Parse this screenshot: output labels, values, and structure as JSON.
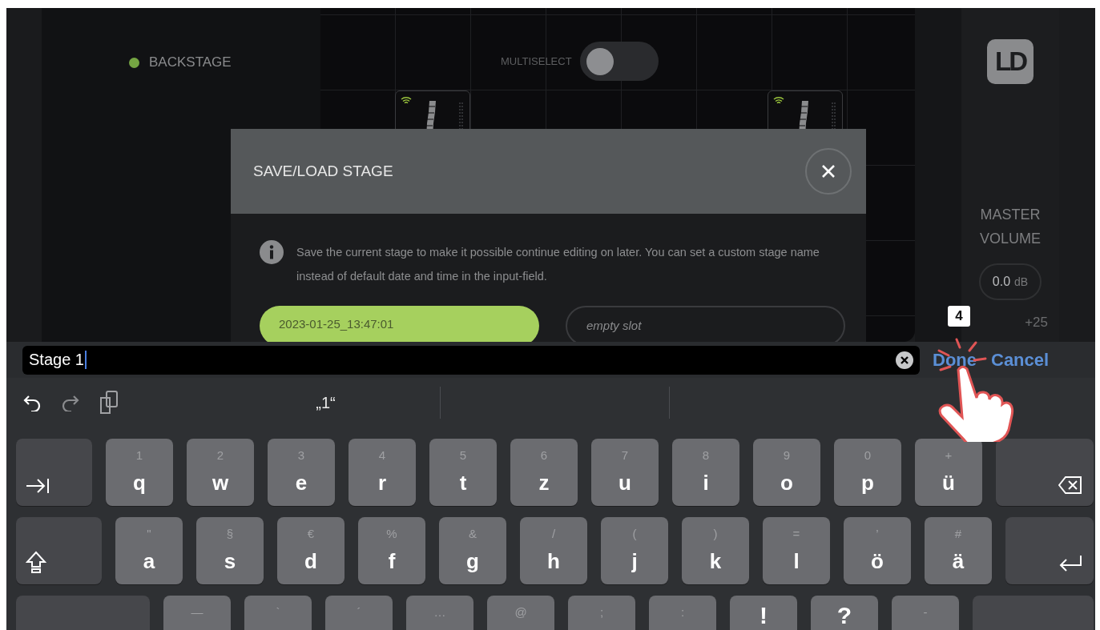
{
  "sidebar": {
    "stage_label": "BACKSTAGE"
  },
  "multiselect": {
    "label": "MULTISELECT",
    "on": false
  },
  "right_panel": {
    "logo": "LD",
    "master_volume": {
      "label": "MASTER VOLUME",
      "value": "0.0",
      "unit": "dB"
    },
    "scale_label": "+25"
  },
  "dialog": {
    "title": "SAVE/LOAD STAGE",
    "info": "Save the current stage to make it possible continue editing on later. You can set a custom stage name instead of default date and time in the input-field.",
    "slots": [
      {
        "label": "2023-01-25_13:47:01",
        "filled": true
      },
      {
        "label": "empty slot",
        "filled": false
      }
    ]
  },
  "input_bar": {
    "value": "Stage 1",
    "done": "Done",
    "cancel": "Cancel"
  },
  "annotation": {
    "step": "4"
  },
  "keyboard": {
    "suggestions": [
      "„1“"
    ],
    "rows": [
      [
        {
          "kind": "tab"
        },
        {
          "kind": "char",
          "hint": "1",
          "label": "q"
        },
        {
          "kind": "char",
          "hint": "2",
          "label": "w"
        },
        {
          "kind": "char",
          "hint": "3",
          "label": "e"
        },
        {
          "kind": "char",
          "hint": "4",
          "label": "r"
        },
        {
          "kind": "char",
          "hint": "5",
          "label": "t"
        },
        {
          "kind": "char",
          "hint": "6",
          "label": "z"
        },
        {
          "kind": "char",
          "hint": "7",
          "label": "u"
        },
        {
          "kind": "char",
          "hint": "8",
          "label": "i"
        },
        {
          "kind": "char",
          "hint": "9",
          "label": "o"
        },
        {
          "kind": "char",
          "hint": "0",
          "label": "p"
        },
        {
          "kind": "char",
          "hint": "+",
          "label": "ü"
        },
        {
          "kind": "backspace"
        }
      ],
      [
        {
          "kind": "shift"
        },
        {
          "kind": "char",
          "hint": "\"",
          "label": "a"
        },
        {
          "kind": "char",
          "hint": "§",
          "label": "s"
        },
        {
          "kind": "char",
          "hint": "€",
          "label": "d"
        },
        {
          "kind": "char",
          "hint": "%",
          "label": "f"
        },
        {
          "kind": "char",
          "hint": "&",
          "label": "g"
        },
        {
          "kind": "char",
          "hint": "/",
          "label": "h"
        },
        {
          "kind": "char",
          "hint": "(",
          "label": "j"
        },
        {
          "kind": "char",
          "hint": ")",
          "label": "k"
        },
        {
          "kind": "char",
          "hint": "=",
          "label": "l"
        },
        {
          "kind": "char",
          "hint": "’",
          "label": "ö"
        },
        {
          "kind": "char",
          "hint": "#",
          "label": "ä"
        },
        {
          "kind": "return"
        }
      ],
      [
        {
          "kind": "blank"
        },
        {
          "kind": "char",
          "hint": "—"
        },
        {
          "kind": "char",
          "hint": "`"
        },
        {
          "kind": "char",
          "hint": "´"
        },
        {
          "kind": "char",
          "hint": "…"
        },
        {
          "kind": "char",
          "hint": "@"
        },
        {
          "kind": "char",
          "hint": ";"
        },
        {
          "kind": "char",
          "hint": ":"
        },
        {
          "kind": "big",
          "label": "!"
        },
        {
          "kind": "big",
          "label": "?"
        },
        {
          "kind": "char",
          "hint": "-"
        },
        {
          "kind": "blank"
        }
      ]
    ]
  }
}
